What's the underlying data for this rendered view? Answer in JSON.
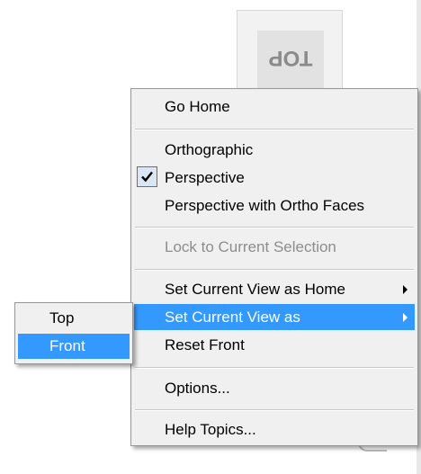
{
  "viewcube": {
    "face_label": "TOP"
  },
  "context_menu": {
    "go_home": "Go Home",
    "orthographic": "Orthographic",
    "perspective": "Perspective",
    "perspective_checked": true,
    "perspective_ortho_faces": "Perspective with Ortho Faces",
    "lock_selection": "Lock to Current Selection",
    "set_view_home": "Set Current View as Home",
    "set_view_as": "Set Current View as",
    "reset_front": "Reset Front",
    "options": "Options...",
    "help_topics": "Help Topics..."
  },
  "submenu": {
    "items": [
      "Top",
      "Front"
    ],
    "highlighted": "Front"
  },
  "colors": {
    "highlight": "#3399ff",
    "menu_bg": "#f0f0f0",
    "disabled_text": "#8d8d8d"
  }
}
